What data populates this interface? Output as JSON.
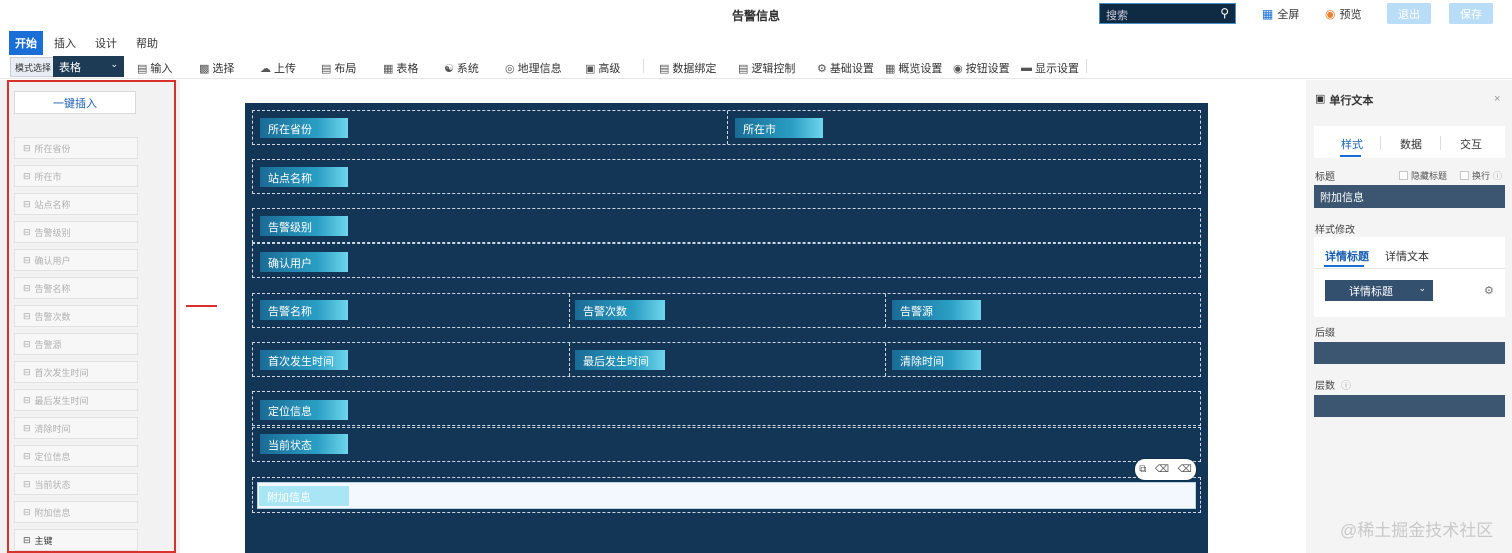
{
  "window": {
    "title": "告警信息"
  },
  "search": {
    "placeholder": "搜索",
    "icon": "search-icon"
  },
  "top_actions": {
    "fullscreen": "全屏",
    "preview": "预览",
    "exit": "退出",
    "save": "保存"
  },
  "menu": {
    "items": [
      "开始",
      "插入",
      "设计",
      "帮助"
    ],
    "active": "开始"
  },
  "toolbar": {
    "style_select_label": "模式选择",
    "style_select_value": "表格",
    "tools": [
      "输入",
      "选择",
      "上传",
      "布局",
      "表格",
      "系统",
      "地理信息",
      "高级",
      "数据绑定",
      "逻辑控制",
      "基础设置",
      "概览设置",
      "按钮设置",
      "显示设置"
    ]
  },
  "left_panel": {
    "insert_button": "一键插入",
    "fields": [
      "所在省份",
      "所在市",
      "站点名称",
      "告警级别",
      "确认用户",
      "告警名称",
      "告警次数",
      "告警源",
      "首次发生时间",
      "最后发生时间",
      "清除时间",
      "定位信息",
      "当前状态",
      "附加信息",
      "主键"
    ]
  },
  "form": {
    "rows": [
      [
        "所在省份",
        "所在市"
      ],
      [
        "站点名称"
      ],
      [
        "告警级别"
      ],
      [
        "确认用户"
      ],
      [
        "告警名称",
        "告警次数",
        "告警源"
      ],
      [
        "首次发生时间",
        "最后发生时间",
        "清除时间"
      ],
      [
        "定位信息"
      ],
      [
        "当前状态"
      ]
    ],
    "selected_field": "附加信息"
  },
  "right_panel": {
    "title": "单行文本",
    "tabs": [
      "样式",
      "数据",
      "交互"
    ],
    "active_tab": "样式",
    "title_label": "标题",
    "hide_title": "隐藏标题",
    "wrap": "换行",
    "title_value": "附加信息",
    "style_modify_label": "样式修改",
    "style_tabs": [
      "详情标题",
      "详情文本"
    ],
    "style_select_value": "详情标题",
    "suffix_label": "后缀",
    "suffix_value": "",
    "layer_label": "层数",
    "layer_value": ""
  },
  "watermark": "@稀土掘金技术社区",
  "colors": {
    "accent": "#1a6fd6",
    "canvas": "#133656",
    "highlight": "#d9312c"
  }
}
